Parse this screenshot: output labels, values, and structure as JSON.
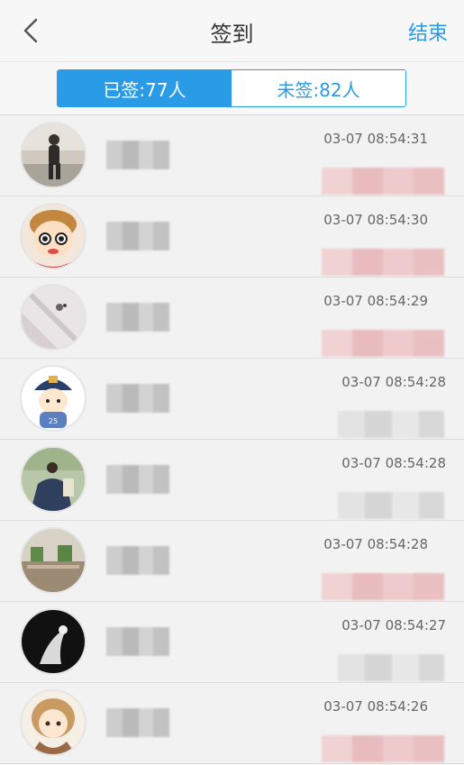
{
  "header": {
    "title": "签到",
    "end_label": "结束"
  },
  "tabs": [
    {
      "label": "已签:77人",
      "active": true
    },
    {
      "label": "未签:82人",
      "active": false
    }
  ],
  "rows": [
    {
      "time": "03-07 08:54:31",
      "avatar": "avatar-photo-person",
      "sub_style": "pink"
    },
    {
      "time": "03-07 08:54:30",
      "avatar": "avatar-cartoon-girl",
      "sub_style": "pink"
    },
    {
      "time": "03-07 08:54:29",
      "avatar": "avatar-photo-light",
      "sub_style": "pink"
    },
    {
      "time": "03-07 08:54:28",
      "avatar": "avatar-cartoon-boy",
      "sub_style": "gray"
    },
    {
      "time": "03-07 08:54:28",
      "avatar": "avatar-photo-outdoor",
      "sub_style": "gray"
    },
    {
      "time": "03-07 08:54:28",
      "avatar": "avatar-photo-building",
      "sub_style": "pink"
    },
    {
      "time": "03-07 08:54:27",
      "avatar": "avatar-photo-dark",
      "sub_style": "gray"
    },
    {
      "time": "03-07 08:54:26",
      "avatar": "avatar-cartoon-anime",
      "sub_style": "pink"
    }
  ],
  "colors": {
    "accent": "#2a9be6",
    "background": "#f2f2f2"
  }
}
